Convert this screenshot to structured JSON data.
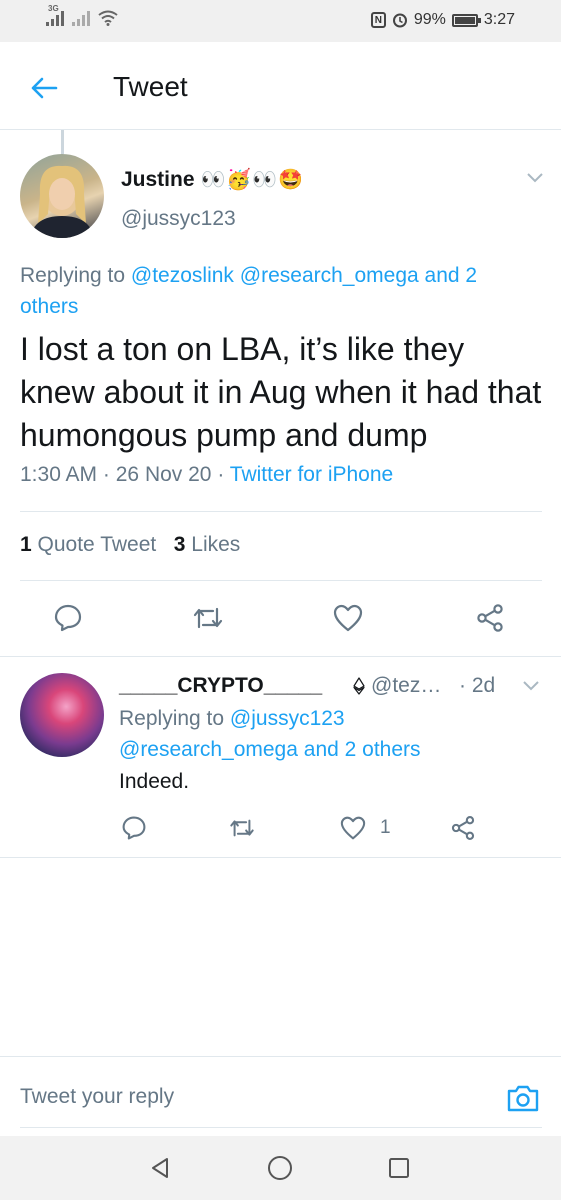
{
  "status_bar": {
    "network_type": "3G",
    "battery_percent": "99%",
    "battery_level": 0.99,
    "time": "3:27"
  },
  "header": {
    "title": "Tweet"
  },
  "tweet": {
    "author_name": "Justine",
    "author_emojis": "👀🥳👀🤩",
    "handle": "@jussyc123",
    "replying_prefix": "Replying to",
    "replying_users": [
      "@tezoslink",
      "@research_omega"
    ],
    "replying_others": "and 2 others",
    "text": "I lost a ton on LBA, it’s like they knew about it in Aug when it had that humongous pump and dump",
    "time": "1:30 AM",
    "separator": "·",
    "date": "26 Nov 20",
    "source": "Twitter for iPhone",
    "quote_count": "1",
    "quote_label": "Quote Tweet",
    "like_count": "3",
    "like_label": "Likes"
  },
  "reply": {
    "name": "_____CRYPTO_____",
    "handle": "@tez…",
    "time": "· 2d",
    "replying_prefix": "Replying to",
    "replying_user1": "@jussyc123",
    "replying_user2": "@research_omega",
    "replying_others": "and 2 others",
    "text": "Indeed.",
    "like_count": "1"
  },
  "compose": {
    "placeholder": "Tweet your reply"
  },
  "colors": {
    "accent": "#1da1f2",
    "secondary_text": "#657786",
    "primary_text": "#14171a",
    "divider": "#e1e8ed"
  }
}
